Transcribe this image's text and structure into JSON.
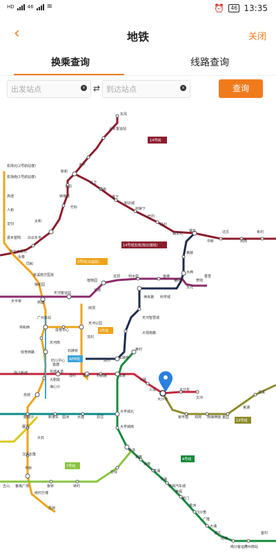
{
  "status_bar": {
    "left_tags": [
      "HD",
      "46",
      "46",
      "HD"
    ],
    "battery": "46",
    "time": "13:35"
  },
  "nav": {
    "title": "地铁",
    "close": "关闭"
  },
  "tabs": [
    {
      "label": "换乘查询",
      "active": true
    },
    {
      "label": "线路查询",
      "active": false
    }
  ],
  "search": {
    "from_placeholder": "出发站点",
    "to_placeholder": "到达站点",
    "swap": "⇄",
    "query": "查询"
  },
  "map": {
    "line_labels": [
      "14号线",
      "14号线支线(知识城线)",
      "3号线(北延段)",
      "3号线",
      "APM线",
      "7号线",
      "13号线",
      "4号线"
    ],
    "stations": [
      "东风",
      "从化客运站",
      "太平",
      "新和",
      "马沥",
      "竹料",
      "钟落潭",
      "红卫",
      "新南",
      "枫下",
      "知识城",
      "何棠下",
      "旺村",
      "汤村",
      "镇龙北",
      "镇龙",
      "中新",
      "坑贝",
      "凤岗",
      "朱村",
      "机场北(2号航站楼)",
      "机场南(1号航站楼)",
      "高增",
      "人和",
      "龙归",
      "嘉禾望岗",
      "白云东平",
      "夏良",
      "太和",
      "竹料",
      "自云大道北",
      "永泰",
      "同和",
      "京溪南方医院",
      "梅花园",
      "燕塘",
      "天河客运站",
      "长湍",
      "植物园",
      "龙洞",
      "柯木塱",
      "金峰",
      "暹岗",
      "苏元",
      "水西",
      "萝岗",
      "香雪",
      "黄陂",
      "天河智慧城",
      "神舟路",
      "科学城",
      "大观南路",
      "岑村",
      "天平架",
      "广州东站",
      "林和西",
      "体育中心",
      "天河南",
      "体育西路",
      "石牌桥",
      "妇儿中心",
      "花城大道",
      "大剧院",
      "海心沙",
      "珠江新城",
      "猎德",
      "潭村",
      "员村",
      "科韵路",
      "车陂",
      "车陂南",
      "黄村",
      "东圃",
      "三溪",
      "鱼珠",
      "大沙地",
      "大沙东",
      "文冲",
      "裕丰围",
      "双岗",
      "南海神庙",
      "夏园",
      "官湖",
      "新沙",
      "万胜围",
      "官洲",
      "大学城北",
      "大学城南",
      "新造",
      "石碁",
      "海傍",
      "低涌",
      "东涌",
      "黄阁汽车城",
      "黄阁",
      "蕉门",
      "金洲",
      "飞沙角",
      "广隆",
      "大涌",
      "塘坑",
      "南横",
      "南沙客运港",
      "广州南站",
      "客村",
      "赤岗",
      "磨碟沙",
      "新港东",
      "琶洲",
      "大塘",
      "沥滘",
      "厦滘",
      "大石",
      "汉溪长隆",
      "市桥",
      "番禺广场",
      "南村万博",
      "员岗",
      "板桥",
      "钟村",
      "谢村",
      "五山",
      "华师",
      "岗顶",
      "天河公园",
      "冼村",
      "白沙",
      "沙村",
      "洛溪",
      "宦溪",
      "渔人"
    ]
  }
}
